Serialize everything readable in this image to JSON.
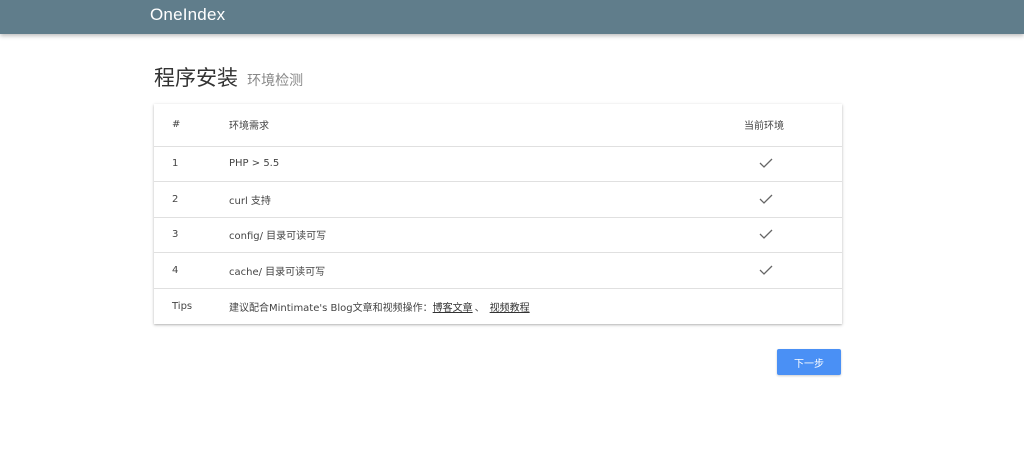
{
  "app": {
    "brand": "OneIndex"
  },
  "page": {
    "title": "程序安装",
    "subtitle": "环境检测"
  },
  "table": {
    "headers": [
      "#",
      "环境需求",
      "当前环境"
    ],
    "rows": [
      {
        "index": "1",
        "requirement": "PHP > 5.5",
        "status": "check-icon"
      },
      {
        "index": "2",
        "requirement": "curl 支持",
        "status": "check-icon"
      },
      {
        "index": "3",
        "requirement": "config/ 目录可读可写",
        "status": "check-icon"
      },
      {
        "index": "4",
        "requirement": "cache/ 目录可读可写",
        "status": "check-icon"
      }
    ],
    "tips": {
      "label": "Tips",
      "text": "建议配合Mintimate's Blog文章和视频操作：",
      "link1": "博客文章",
      "separator": "、",
      "link2": "视频教程"
    }
  },
  "actions": {
    "next_label": "下一步"
  },
  "colors": {
    "topbar": "#607d8b",
    "button": "#4a90f5",
    "check": "#666666"
  }
}
